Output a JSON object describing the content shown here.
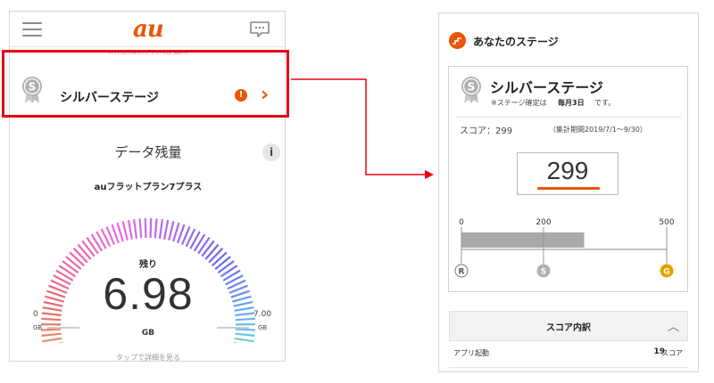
{
  "colors": {
    "accent": "#eb5505",
    "highlight": "#e60012",
    "bar_fill": "#a9a9a9",
    "silver": "#b0b0b0",
    "gold": "#e6a100"
  },
  "left": {
    "logo": "au",
    "date": "2019/08/02 11:39 時点",
    "silver_row": {
      "label": "シルバーステージ",
      "alert": "!",
      "chevron": "›"
    },
    "data": {
      "title": "データ残量",
      "info": "i",
      "plan": "auフラットプラン7プラス",
      "remaining_label": "残り",
      "remaining_value": "6.98",
      "remaining_unit": "GB",
      "min": "0",
      "min_unit": "GB",
      "max": "7.00",
      "max_unit": "GB",
      "fraction_remaining": 0.997,
      "tap_hint": "タップで詳細を見る"
    }
  },
  "right": {
    "header_title": "あなたのステージ",
    "stage_name": "シルバーステージ",
    "note_a": "※ステージ確定は",
    "note_b": "毎月3日",
    "note_c": "です。",
    "score_line": "スコア：299",
    "score_period": "（集計期間2019/7/1～9/30）",
    "score_value": "299",
    "bar": {
      "score": 299,
      "max": 500,
      "ticks": [
        {
          "value": 0,
          "label": "0"
        },
        {
          "value": 200,
          "label": "200"
        },
        {
          "value": 500,
          "label": "500"
        }
      ],
      "stages": [
        {
          "value": 0,
          "letter": "R"
        },
        {
          "value": 200,
          "letter": "S"
        },
        {
          "value": 500,
          "letter": "G"
        }
      ]
    },
    "breakdown_title": "スコア内訳",
    "breakdown_chevron": "︿",
    "row_label": "アプリ起動",
    "row_value": "19",
    "row_unit": "スコア"
  }
}
